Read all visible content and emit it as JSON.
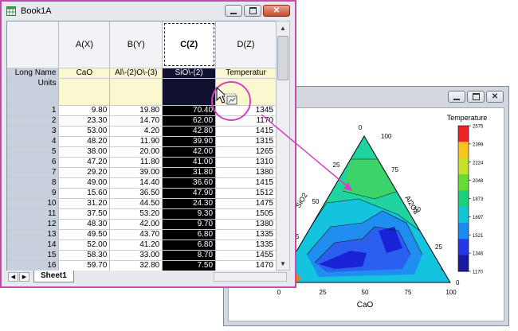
{
  "workbook": {
    "title": "Book1A",
    "columns": [
      {
        "header": "A(X)",
        "long_name": "CaO",
        "units": ""
      },
      {
        "header": "B(Y)",
        "long_name": "Al\\-(2)O\\-(3)",
        "units": ""
      },
      {
        "header": "C(Z)",
        "long_name": "SiO\\-(2)",
        "units": ""
      },
      {
        "header": "D(Z)",
        "long_name": "Temperatur",
        "units": ""
      }
    ],
    "row_labels": {
      "long_name": "Long Name",
      "units": "Units"
    },
    "rows": [
      {
        "n": "1",
        "a": "9.80",
        "b": "19.80",
        "c": "70.40",
        "d": "1345"
      },
      {
        "n": "2",
        "a": "23.30",
        "b": "14.70",
        "c": "62.00",
        "d": "1170"
      },
      {
        "n": "3",
        "a": "53.00",
        "b": "4.20",
        "c": "42.80",
        "d": "1415"
      },
      {
        "n": "4",
        "a": "48.20",
        "b": "11.90",
        "c": "39.90",
        "d": "1315"
      },
      {
        "n": "5",
        "a": "38.00",
        "b": "20.00",
        "c": "42.00",
        "d": "1265"
      },
      {
        "n": "6",
        "a": "47.20",
        "b": "11.80",
        "c": "41.00",
        "d": "1310"
      },
      {
        "n": "7",
        "a": "29.20",
        "b": "39.00",
        "c": "31.80",
        "d": "1380"
      },
      {
        "n": "8",
        "a": "49.00",
        "b": "14.40",
        "c": "36.60",
        "d": "1415"
      },
      {
        "n": "9",
        "a": "15.60",
        "b": "36.50",
        "c": "47.90",
        "d": "1512"
      },
      {
        "n": "10",
        "a": "31.20",
        "b": "44.50",
        "c": "24.30",
        "d": "1475"
      },
      {
        "n": "11",
        "a": "37.50",
        "b": "53.20",
        "c": "9.30",
        "d": "1505"
      },
      {
        "n": "12",
        "a": "48.30",
        "b": "42.00",
        "c": "9.70",
        "d": "1380"
      },
      {
        "n": "13",
        "a": "49.50",
        "b": "43.70",
        "c": "6.80",
        "d": "1335"
      },
      {
        "n": "14",
        "a": "52.00",
        "b": "41.20",
        "c": "6.80",
        "d": "1335"
      },
      {
        "n": "15",
        "a": "58.30",
        "b": "33.00",
        "c": "8.70",
        "d": "1455"
      },
      {
        "n": "16",
        "a": "59.70",
        "b": "32.80",
        "c": "7.50",
        "d": "1470"
      }
    ],
    "sheet_tab": "Sheet1",
    "selected_column": "C(Z)",
    "selection_color": "#000000",
    "highlight_color": "#c64aa8"
  },
  "graph": {
    "legend_title": "Temperature",
    "legend_levels": [
      "2575",
      "2399",
      "2224",
      "2048",
      "1873",
      "1697",
      "1521",
      "1346",
      "1170"
    ],
    "axis_bottom": {
      "label": "CaO",
      "ticks": [
        "0",
        "25",
        "50",
        "75",
        "100"
      ]
    },
    "axis_right": {
      "label": "Al2O3",
      "ticks": [
        "100",
        "75",
        "50",
        "25",
        "0"
      ]
    },
    "axis_left": {
      "label": "SiO2",
      "ticks": [
        "0",
        "25",
        "50",
        "75"
      ]
    }
  },
  "chart_data": {
    "type": "heatmap",
    "subtype": "ternary-contour",
    "title": "",
    "colorbar_title": "Temperature",
    "colorbar_ticks": [
      2575,
      2399,
      2224,
      2048,
      1873,
      1697,
      1521,
      1346,
      1170
    ],
    "colorbar_colors": [
      "#f02424",
      "#f8c51e",
      "#c8e025",
      "#66dd30",
      "#19d07c",
      "#12c6d4",
      "#1a8cf0",
      "#2038e6",
      "#1a1aa0"
    ],
    "axes": {
      "bottom": "CaO",
      "right": "Al2O3",
      "left": "SiO2"
    },
    "axis_range": [
      0,
      100
    ],
    "points": [
      {
        "CaO": 9.8,
        "Al2O3": 19.8,
        "SiO2": 70.4,
        "Temperature": 1345
      },
      {
        "CaO": 23.3,
        "Al2O3": 14.7,
        "SiO2": 62.0,
        "Temperature": 1170
      },
      {
        "CaO": 53.0,
        "Al2O3": 4.2,
        "SiO2": 42.8,
        "Temperature": 1415
      },
      {
        "CaO": 48.2,
        "Al2O3": 11.9,
        "SiO2": 39.9,
        "Temperature": 1315
      },
      {
        "CaO": 38.0,
        "Al2O3": 20.0,
        "SiO2": 42.0,
        "Temperature": 1265
      },
      {
        "CaO": 47.2,
        "Al2O3": 11.8,
        "SiO2": 41.0,
        "Temperature": 1310
      },
      {
        "CaO": 29.2,
        "Al2O3": 39.0,
        "SiO2": 31.8,
        "Temperature": 1380
      },
      {
        "CaO": 49.0,
        "Al2O3": 14.4,
        "SiO2": 36.6,
        "Temperature": 1415
      },
      {
        "CaO": 15.6,
        "Al2O3": 36.5,
        "SiO2": 47.9,
        "Temperature": 1512
      },
      {
        "CaO": 31.2,
        "Al2O3": 44.5,
        "SiO2": 24.3,
        "Temperature": 1475
      },
      {
        "CaO": 37.5,
        "Al2O3": 53.2,
        "SiO2": 9.3,
        "Temperature": 1505
      },
      {
        "CaO": 48.3,
        "Al2O3": 42.0,
        "SiO2": 9.7,
        "Temperature": 1380
      },
      {
        "CaO": 49.5,
        "Al2O3": 43.7,
        "SiO2": 6.8,
        "Temperature": 1335
      },
      {
        "CaO": 52.0,
        "Al2O3": 41.2,
        "SiO2": 6.8,
        "Temperature": 1335
      },
      {
        "CaO": 58.3,
        "Al2O3": 33.0,
        "SiO2": 8.7,
        "Temperature": 1455
      },
      {
        "CaO": 59.7,
        "Al2O3": 32.8,
        "SiO2": 7.5,
        "Temperature": 1470
      }
    ]
  }
}
